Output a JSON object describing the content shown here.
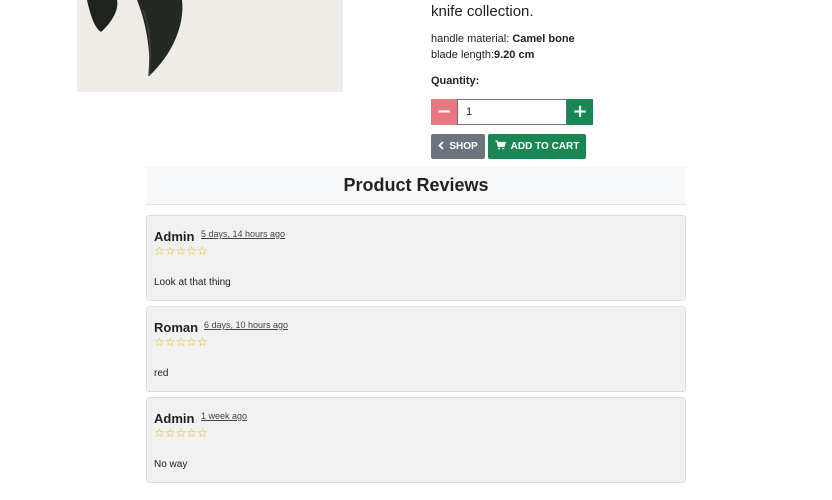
{
  "product": {
    "description_tail": "knife collection.",
    "specs": {
      "handle_label": "handle material: ",
      "handle_value": "Camel bone",
      "blade_label": "blade length:",
      "blade_value": "9.20 cm"
    },
    "quantity": {
      "label": "Quantity:",
      "value": "1",
      "minus_label": "−",
      "plus_label": "+"
    },
    "buttons": {
      "shop_label": "SHOP",
      "cart_label": "ADD TO CART"
    }
  },
  "reviews": {
    "title": "Product Reviews",
    "items": [
      {
        "author": "Admin",
        "time": "5 days, 14 hours ago",
        "stars": "☆☆☆☆☆",
        "rating": 5,
        "text": "Look at that thing"
      },
      {
        "author": "Roman",
        "time": "6 days, 10 hours ago",
        "stars": "☆☆☆☆☆",
        "rating": 5,
        "text": "red"
      },
      {
        "author": "Admin",
        "time": "1 week ago",
        "stars": "☆☆☆☆☆",
        "rating": 5,
        "text": "No way"
      }
    ]
  },
  "colors": {
    "shop_button": "#6c757d",
    "cart_button": "#198754",
    "minus_button": "#e77781",
    "star": "#e6b800"
  }
}
